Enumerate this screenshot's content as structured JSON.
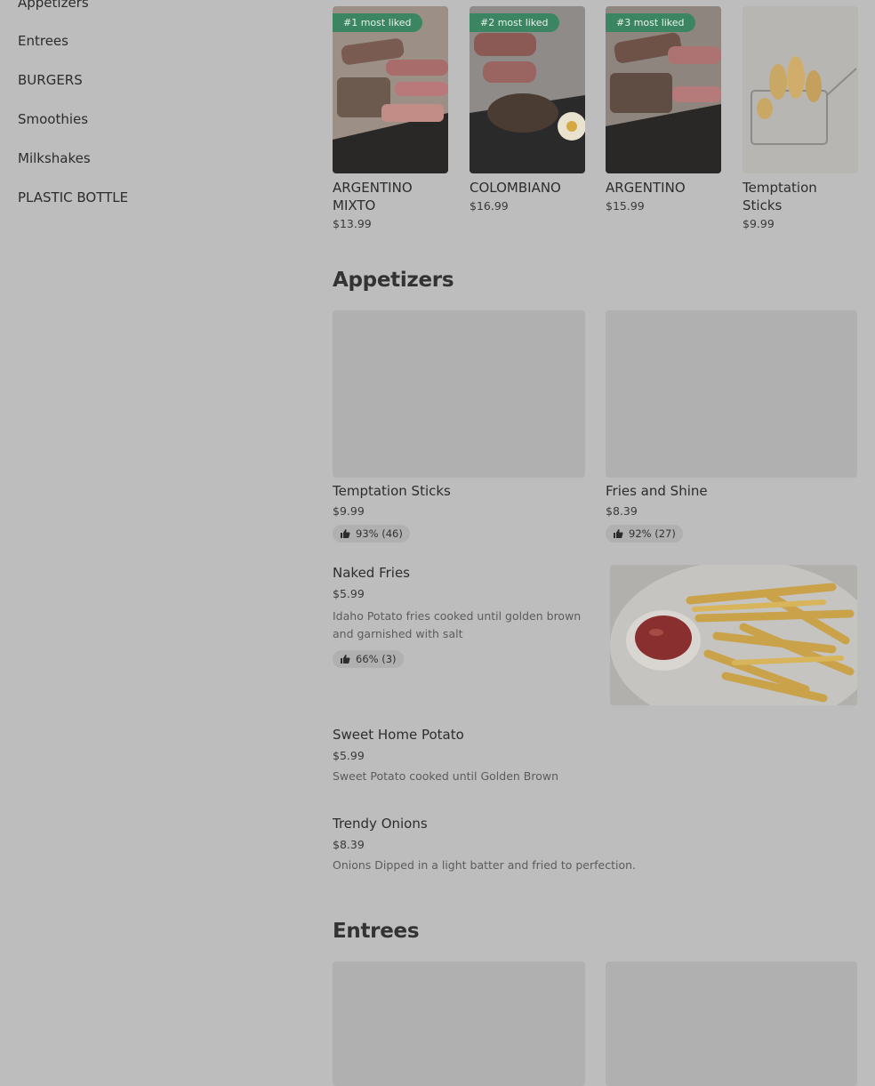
{
  "sidebar": {
    "items": [
      {
        "label": "Appetizers"
      },
      {
        "label": "Entrees"
      },
      {
        "label": "BURGERS"
      },
      {
        "label": "Smoothies"
      },
      {
        "label": "Milkshakes"
      },
      {
        "label": "PLASTIC BOTTLE"
      }
    ]
  },
  "popular": [
    {
      "badge": "#1 most liked",
      "name": "ARGENTINO MIXTO",
      "price": "$13.99"
    },
    {
      "badge": "#2 most liked",
      "name": "COLOMBIANO",
      "price": "$16.99"
    },
    {
      "badge": "#3 most liked",
      "name": "ARGENTINO",
      "price": "$15.99"
    },
    {
      "badge": "",
      "name": "Temptation Sticks",
      "price": "$9.99"
    }
  ],
  "appetizers": {
    "title": "Appetizers",
    "grid": [
      {
        "name": "Temptation Sticks",
        "price": "$9.99",
        "rating": "93% (46)"
      },
      {
        "name": "Fries and Shine",
        "price": "$8.39",
        "rating": "92% (27)"
      }
    ],
    "list": [
      {
        "name": "Naked Fries",
        "price": "$5.99",
        "desc": "Idaho Potato fries cooked until golden brown and garnished with salt",
        "rating": "66% (3)"
      },
      {
        "name": "Sweet Home Potato",
        "price": "$5.99",
        "desc": "Sweet Potato cooked until Golden Brown"
      },
      {
        "name": "Trendy Onions",
        "price": "$8.39",
        "desc": "Onions Dipped in a light batter and fried to perfection."
      }
    ]
  },
  "entrees": {
    "title": "Entrees"
  },
  "colors": {
    "badge": "#3b8562",
    "overlay": "#bdbdbd"
  }
}
